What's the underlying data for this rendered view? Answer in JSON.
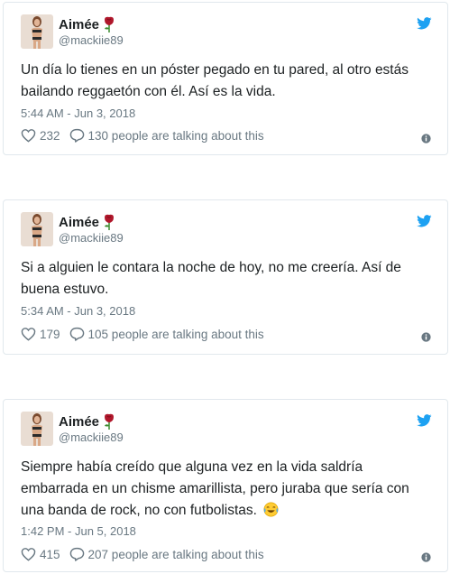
{
  "colors": {
    "text": "#1c2022",
    "secondary": "#697882",
    "twitter_blue": "#1da1f2",
    "border": "#e1e8ed",
    "rose": "#b0172b"
  },
  "icons": [
    "twitter-bird-icon",
    "rose-emoji-icon",
    "heart-icon",
    "reply-bubble-icon",
    "info-icon",
    "tears-of-joy-emoji-icon"
  ],
  "tweets": [
    {
      "author_name": "Aimée",
      "handle": "@mackiie89",
      "text": "Un día lo tienes en un póster pegado en tu pared, al otro estás bailando reggaetón con él. Así es la vida.",
      "timestamp": "5:44 AM - Jun 3, 2018",
      "likes": "232",
      "talking": "130 people are talking about this"
    },
    {
      "author_name": "Aimée",
      "handle": "@mackiie89",
      "text": "Si a alguien le contara la noche de hoy, no me creería. Así de buena estuvo.",
      "timestamp": "5:34 AM - Jun 3, 2018",
      "likes": "179",
      "talking": "105 people are talking about this"
    },
    {
      "author_name": "Aimée",
      "handle": "@mackiie89",
      "text": "Siempre había creído que alguna vez en la vida saldría embarrada en un chisme amarillista, pero juraba que sería con una banda de rock, no con futbolistas.",
      "timestamp": "1:42 PM - Jun 5, 2018",
      "likes": "415",
      "talking": "207 people are talking about this"
    }
  ]
}
